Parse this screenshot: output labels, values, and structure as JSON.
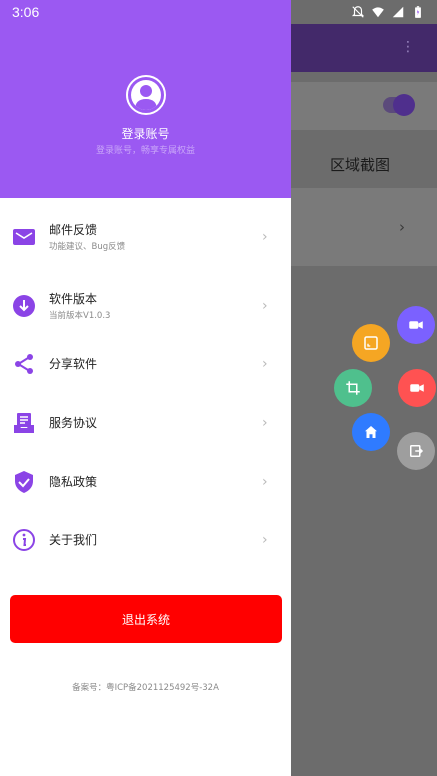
{
  "status_bar": {
    "time": "3:06"
  },
  "background_app": {
    "section_title": "区域截图",
    "accent_color": "#43296a"
  },
  "drawer": {
    "header": {
      "title": "登录账号",
      "subtitle": "登录账号，畅享专属权益",
      "background_color": "#9b59f2"
    },
    "menu": [
      {
        "label": "邮件反馈",
        "sub": "功能建议、Bug反馈",
        "icon": "mail-icon"
      },
      {
        "label": "软件版本",
        "sub": "当前版本V1.0.3",
        "icon": "download-icon"
      },
      {
        "label": "分享软件",
        "sub": "",
        "icon": "share-icon"
      },
      {
        "label": "服务协议",
        "sub": "",
        "icon": "agreement-icon"
      },
      {
        "label": "隐私政策",
        "sub": "",
        "icon": "shield-icon"
      },
      {
        "label": "关于我们",
        "sub": "",
        "icon": "info-icon"
      }
    ],
    "logout_label": "退出系统",
    "icp": "备案号：粤ICP备2021125492号-32A"
  },
  "fab_colors": {
    "record": "#7b61ff",
    "region": "#f5a623",
    "crop": "#4fc08d",
    "video": "#ff5252",
    "home": "#2f7bff",
    "exit": "#9e9e9e"
  }
}
